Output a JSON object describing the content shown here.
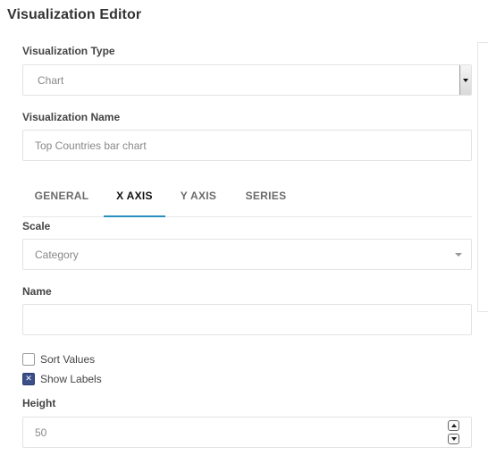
{
  "editor": {
    "title": "Visualization Editor"
  },
  "type_field": {
    "label": "Visualization Type",
    "value": "Chart"
  },
  "name_field": {
    "label": "Visualization Name",
    "value": "Top Countries bar chart"
  },
  "tabs": [
    {
      "label": "GENERAL",
      "active": false
    },
    {
      "label": "X AXIS",
      "active": true
    },
    {
      "label": "Y AXIS",
      "active": false
    },
    {
      "label": "SERIES",
      "active": false
    }
  ],
  "x_axis": {
    "scale_label": "Scale",
    "scale_value": "Category",
    "name_label": "Name",
    "name_value": "",
    "sort_values": {
      "label": "Sort Values",
      "checked": false
    },
    "show_labels": {
      "label": "Show Labels",
      "checked": true
    },
    "height_label": "Height",
    "height_value": "50"
  },
  "colors": {
    "active_tab_underline": "#2a8fbd",
    "checkbox_checked": "#3b4f8a"
  }
}
